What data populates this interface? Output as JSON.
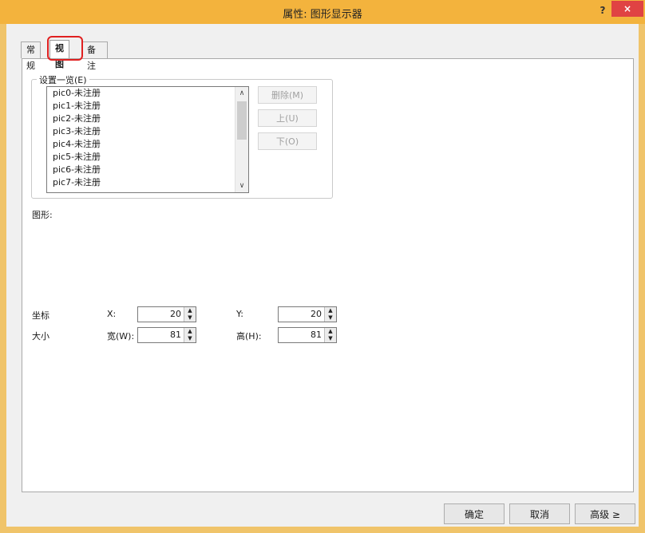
{
  "window": {
    "title": "属性: 图形显示器",
    "help_label": "?",
    "close_label": "×"
  },
  "tabs": [
    {
      "label": "常规"
    },
    {
      "label": "视图"
    },
    {
      "label": "备注"
    }
  ],
  "settings_list": {
    "group_title": "设置一览(E)",
    "items": [
      "pic0-未注册",
      "pic1-未注册",
      "pic2-未注册",
      "pic3-未注册",
      "pic4-未注册",
      "pic5-未注册",
      "pic6-未注册",
      "pic7-未注册"
    ],
    "scroll_up": "∧",
    "scroll_down": "∨",
    "delete_label": "删除(M)",
    "up_label": "上(U)",
    "down_label": "下(O)"
  },
  "graphic": {
    "label": "图形:"
  },
  "coords": {
    "label": "坐标",
    "x_label": "X:",
    "x_value": "20",
    "y_label": "Y:",
    "y_value": "20"
  },
  "size": {
    "label": "大小",
    "w_label": "宽(W):",
    "w_value": "81",
    "h_label": "高(H):",
    "h_value": "81"
  },
  "spin": {
    "up": "▲",
    "down": "▼"
  },
  "footer": {
    "ok_label": "确定",
    "cancel_label": "取消",
    "advanced_label": "高级 ≥"
  },
  "colors": {
    "title_bar": "#f3b33d",
    "close_button": "#e04343",
    "highlight": "#e02020"
  }
}
